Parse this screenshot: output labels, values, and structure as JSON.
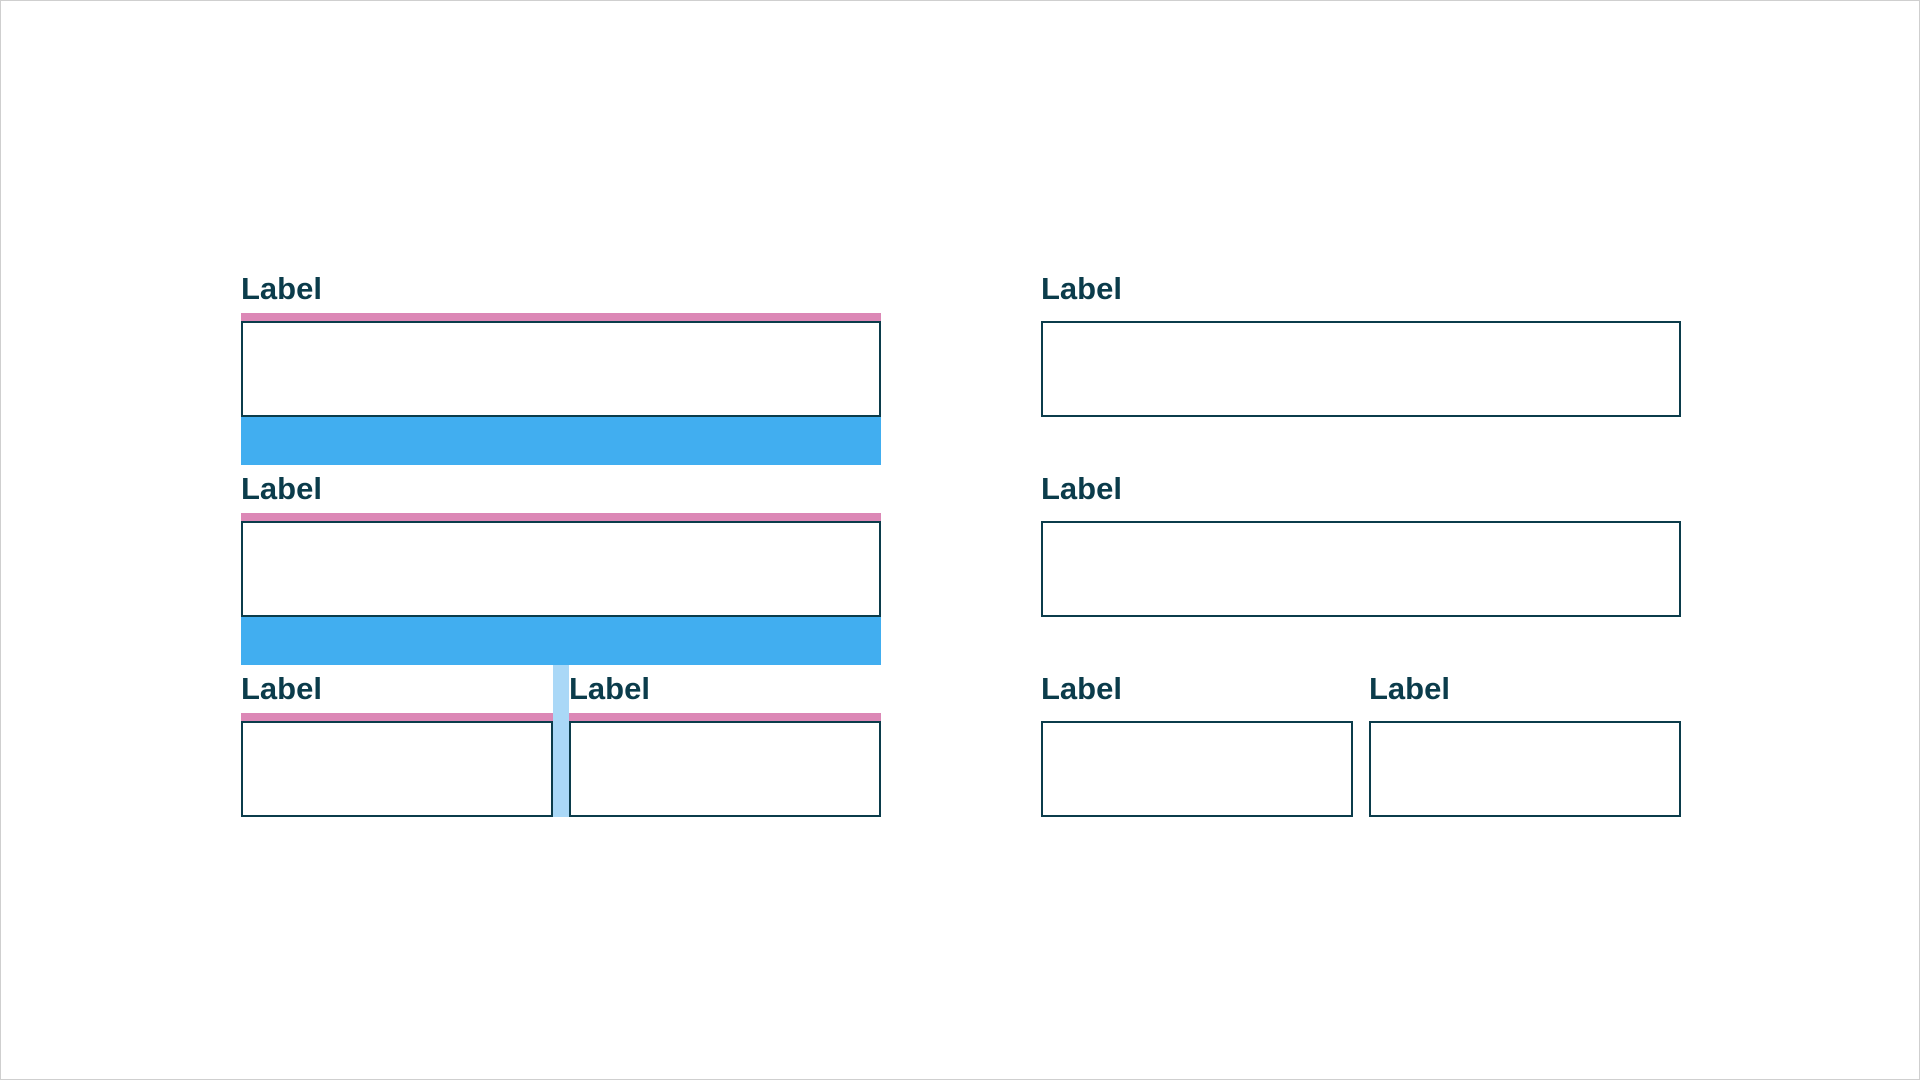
{
  "colors": {
    "label_text": "#0b3c4b",
    "field_border": "#0b3c4b",
    "label_spacing_highlight": "#dc88b6",
    "row_spacing_highlight": "#41aef0",
    "column_gap_highlight": "#aad8f7"
  },
  "annotated": {
    "row1": {
      "label": "Label"
    },
    "row2": {
      "label": "Label"
    },
    "row3": {
      "left_label": "Label",
      "right_label": "Label"
    }
  },
  "plain": {
    "row1": {
      "label": "Label"
    },
    "row2": {
      "label": "Label"
    },
    "row3": {
      "left_label": "Label",
      "right_label": "Label"
    }
  }
}
